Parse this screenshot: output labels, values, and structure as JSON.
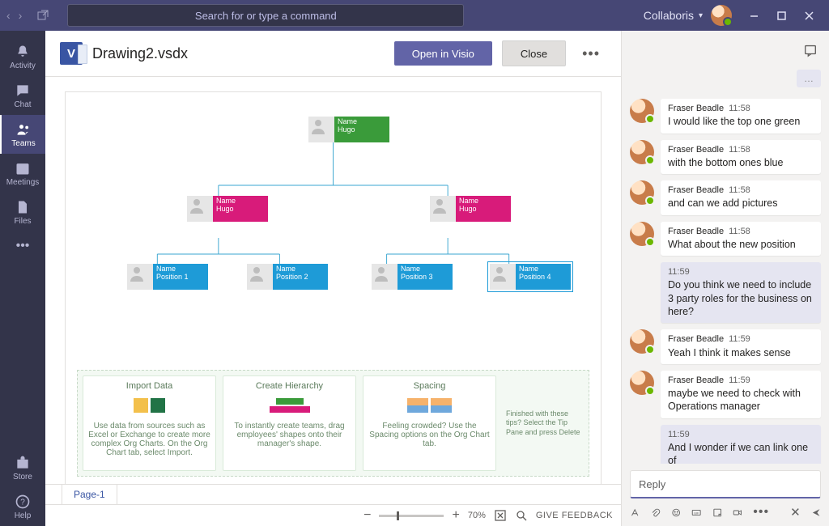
{
  "titlebar": {
    "search_placeholder": "Search for or type a command",
    "org_name": "Collaboris"
  },
  "rail": {
    "activity": "Activity",
    "chat": "Chat",
    "teams": "Teams",
    "meetings": "Meetings",
    "files": "Files",
    "store": "Store",
    "help": "Help"
  },
  "doc": {
    "filename": "Drawing2.vsdx",
    "open_label": "Open in Visio",
    "close_label": "Close",
    "page_tab": "Page-1",
    "zoom_pct": "70%",
    "feedback": "GIVE FEEDBACK"
  },
  "org_nodes": {
    "top": {
      "line1": "Name",
      "line2": "Hugo"
    },
    "l2a": {
      "line1": "Name",
      "line2": "Hugo"
    },
    "l2b": {
      "line1": "Name",
      "line2": "Hugo"
    },
    "p1": {
      "line1": "Name",
      "line2": "Position 1"
    },
    "p2": {
      "line1": "Name",
      "line2": "Position 2"
    },
    "p3": {
      "line1": "Name",
      "line2": "Position 3"
    },
    "p4": {
      "line1": "Name",
      "line2": "Position 4"
    }
  },
  "tips": {
    "t1_title": "Import Data",
    "t1_body": "Use data from sources such as Excel or Exchange to create more complex Org Charts. On the Org Chart tab, select Import.",
    "t2_title": "Create Hierarchy",
    "t2_body": "To instantly create teams, drag employees' shapes onto their manager's shape.",
    "t3_title": "Spacing",
    "t3_body": "Feeling crowded? Use the Spacing options on the Org Chart tab.",
    "note": "Finished with these tips? Select the Tip Pane and press Delete"
  },
  "chat": {
    "truncated": "…",
    "m1": {
      "name": "Fraser Beadle",
      "time": "11:58",
      "text": "I would like the top one green"
    },
    "m2": {
      "name": "Fraser Beadle",
      "time": "11:58",
      "text": "with the bottom ones blue"
    },
    "m3": {
      "name": "Fraser Beadle",
      "time": "11:58",
      "text": "and can we add pictures"
    },
    "m4": {
      "name": "Fraser Beadle",
      "time": "11:58",
      "text": "What about the new position"
    },
    "me1": {
      "time": "11:59",
      "text": "Do you think we need to include 3 party roles for the business on here?"
    },
    "m5": {
      "name": "Fraser Beadle",
      "time": "11:59",
      "text": "Yeah I think it makes sense"
    },
    "m6": {
      "name": "Fraser Beadle",
      "time": "11:59",
      "text": "maybe we need to check with Operations manager"
    },
    "me2": {
      "time": "11:59",
      "text": "And I wonder if we can link one of"
    },
    "reply_placeholder": "Reply"
  }
}
